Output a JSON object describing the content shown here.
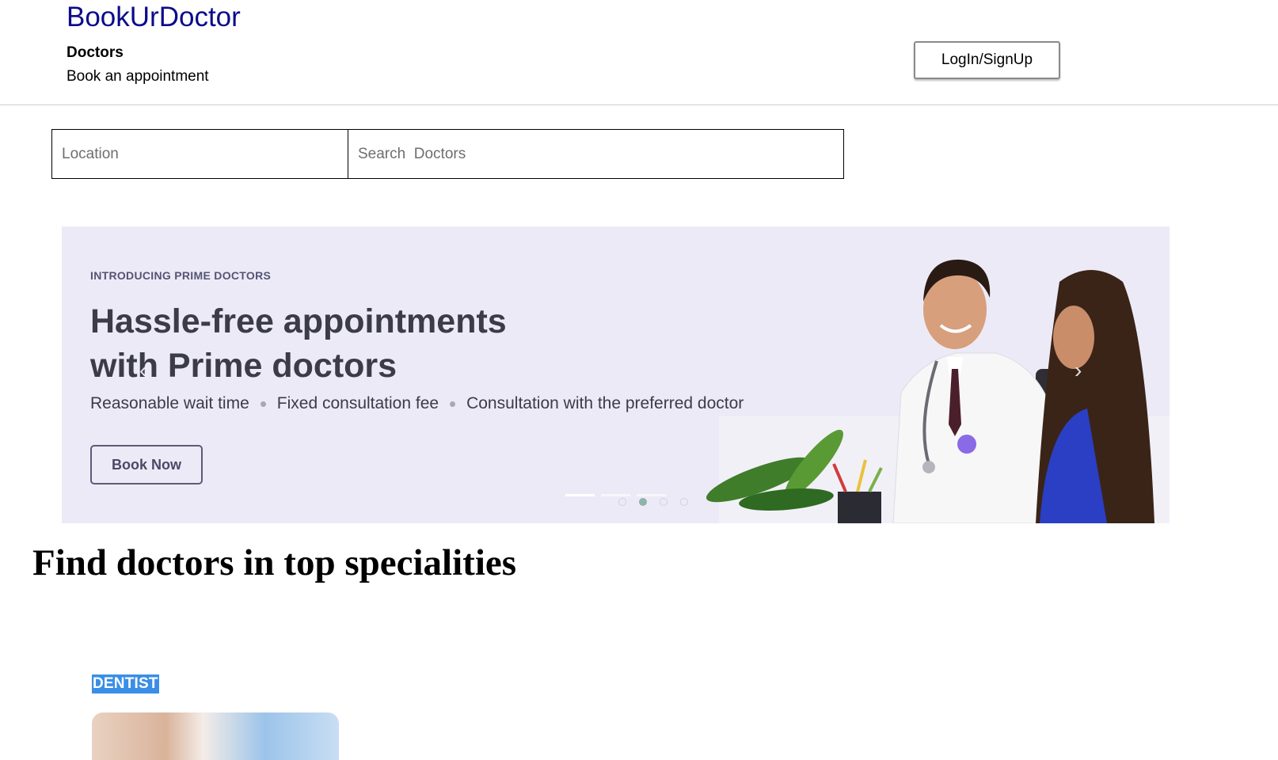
{
  "header": {
    "brand": "BookUrDoctor",
    "nav_title": "Doctors",
    "nav_subtitle": "Book an appointment",
    "login_label": "LogIn/SignUp"
  },
  "search": {
    "location_placeholder": "Location",
    "doctors_placeholder": "Search  Doctors"
  },
  "banner": {
    "eyebrow": "INTRODUCING PRIME DOCTORS",
    "headline_line1": "Hassle-free appointments",
    "headline_line2": "with Prime doctors",
    "features": [
      "Reasonable wait time",
      "Fixed consultation fee",
      "Consultation with the preferred doctor"
    ],
    "cta_label": "Book Now",
    "colors": {
      "background": "#edeaf7",
      "text": "#3c3b48"
    }
  },
  "section": {
    "title": "Find doctors in top specialities"
  },
  "specialities": [
    {
      "label": "DENTIST"
    }
  ],
  "colors": {
    "brand": "#0b0b8a",
    "speciality_highlight": "#3a8ee6"
  }
}
